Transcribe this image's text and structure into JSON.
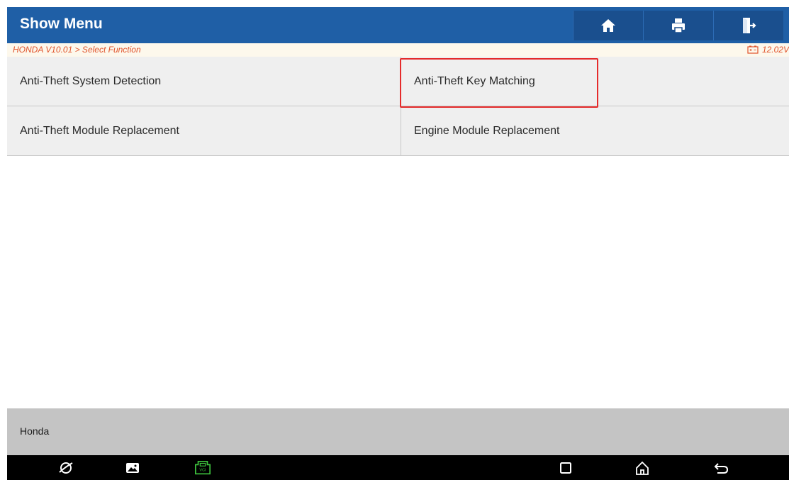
{
  "header": {
    "title": "Show Menu",
    "home_icon": "home-icon",
    "print_icon": "print-icon",
    "exit_icon": "exit-icon",
    "bg_color": "#1f5fa6"
  },
  "breadcrumb": {
    "path": "HONDA V10.01 > Select Function",
    "battery_icon": "battery-icon",
    "voltage": "12.02V",
    "accent_color": "#e0522a"
  },
  "menu": {
    "items": [
      {
        "label": "Anti-Theft System Detection"
      },
      {
        "label": "Anti-Theft Key Matching",
        "highlighted": true
      },
      {
        "label": "Anti-Theft Module Replacement"
      },
      {
        "label": "Engine Module Replacement"
      }
    ],
    "highlight_color": "#e52b2b"
  },
  "footer": {
    "text": "Honda"
  },
  "nav_bar": {
    "icons": [
      "browser-icon",
      "gallery-icon",
      "vci-icon",
      "recents-icon",
      "home-icon",
      "back-icon"
    ],
    "vci_label": "VCI"
  }
}
